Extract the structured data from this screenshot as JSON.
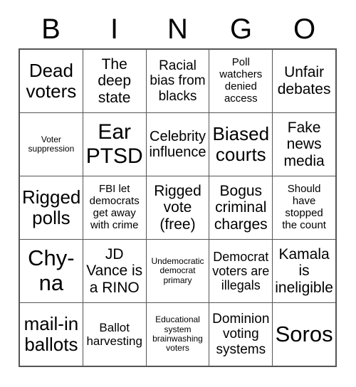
{
  "header": {
    "letters": [
      "B",
      "I",
      "N",
      "G",
      "O"
    ]
  },
  "grid": {
    "rows": 5,
    "columns": 5,
    "cells": [
      {
        "text": "Dead\nvoters",
        "size": "lg",
        "free": false
      },
      {
        "text": "The\ndeep\nstate",
        "size": "md",
        "free": false
      },
      {
        "text": "Racial\nbias from\nblacks",
        "size": "md",
        "free": false
      },
      {
        "text": "Poll\nwatchers\ndenied\naccess",
        "size": "sm",
        "free": false
      },
      {
        "text": "Unfair\ndebates",
        "size": "md",
        "free": false
      },
      {
        "text": "Voter\nsuppression",
        "size": "xs",
        "free": false
      },
      {
        "text": "Ear\nPTSD",
        "size": "xl",
        "free": false
      },
      {
        "text": "Celebrity\ninfluence",
        "size": "md",
        "free": false
      },
      {
        "text": "Biased\ncourts",
        "size": "lg",
        "free": false
      },
      {
        "text": "Fake\nnews\nmedia",
        "size": "md",
        "free": false
      },
      {
        "text": "Rigged\npolls",
        "size": "lg",
        "free": false
      },
      {
        "text": "FBI let\ndemocrats\nget away\nwith crime",
        "size": "sm",
        "free": false
      },
      {
        "text": "Rigged\nvote\n(free)",
        "size": "md",
        "free": true
      },
      {
        "text": "Bogus\ncriminal\ncharges",
        "size": "md",
        "free": false
      },
      {
        "text": "Should\nhave\nstopped\nthe count",
        "size": "sm",
        "free": false
      },
      {
        "text": "Chy-\nna",
        "size": "xl",
        "free": false
      },
      {
        "text": "JD\nVance is\na RINO",
        "size": "md",
        "free": false
      },
      {
        "text": "Undemocratic\ndemocrat\nprimary",
        "size": "xs",
        "free": false
      },
      {
        "text": "Democrat\nvoters are\nillegals",
        "size": "md",
        "free": false
      },
      {
        "text": "Kamala\nis\nineligible",
        "size": "md",
        "free": false
      },
      {
        "text": "mail-in\nballots",
        "size": "lg",
        "free": false
      },
      {
        "text": "Ballot\nharvesting",
        "size": "md",
        "free": false
      },
      {
        "text": "Educational\nsystem\nbrainwashing\nvoters",
        "size": "xs",
        "free": false
      },
      {
        "text": "Dominion\nvoting\nsystems",
        "size": "md",
        "free": false
      },
      {
        "text": "Soros",
        "size": "xl",
        "free": false
      }
    ]
  },
  "colors": {
    "background": "#ffffff",
    "text": "#000000",
    "gridline": "#555555"
  }
}
